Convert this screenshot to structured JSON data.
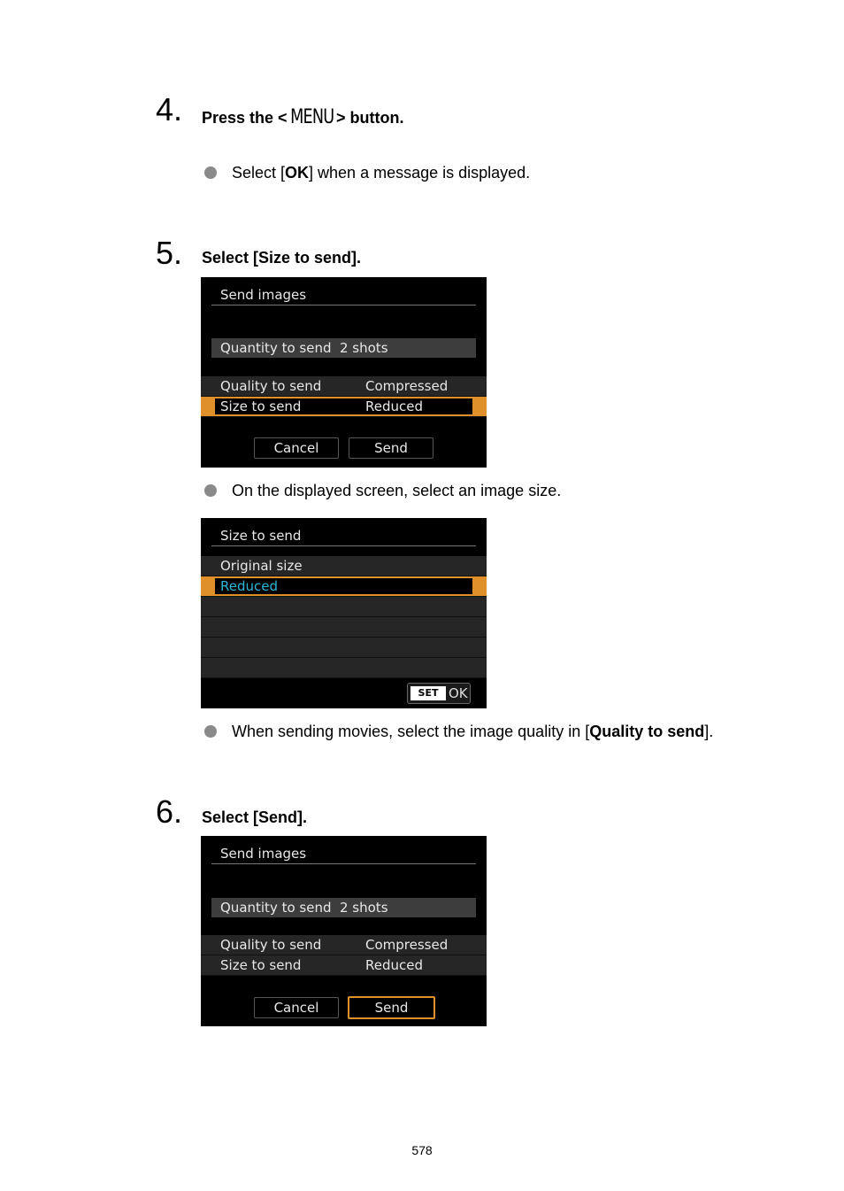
{
  "steps": [
    {
      "number": "4.",
      "title_prefix": "Press the <",
      "title_glyph": "MENU",
      "title_suffix": "> button.",
      "bullets": [
        {
          "pre": "Select [",
          "bold": "OK",
          "post": "] when a message is displayed."
        }
      ]
    },
    {
      "number": "5.",
      "title": "Select [Size to send].",
      "bullets": [
        {
          "text": "On the displayed screen, select an image size."
        },
        {
          "pre": "When sending movies, select the image quality in [",
          "bold": "Quality to send",
          "post": "]."
        }
      ]
    },
    {
      "number": "6.",
      "title": "Select [Send]."
    }
  ],
  "screens": {
    "send_images_a": {
      "title": "Send images",
      "quantity_label": "Quantity to send",
      "quantity_value": "2 shots",
      "rows": [
        {
          "label": "Quality to send",
          "value": "Compressed",
          "selected": false
        },
        {
          "label": "Size to send",
          "value": "Reduced",
          "selected": true
        }
      ],
      "cancel_label": "Cancel",
      "send_label": "Send",
      "focused_button": "none"
    },
    "size_to_send": {
      "title": "Size to send",
      "options": [
        {
          "label": "Original size",
          "selected": false
        },
        {
          "label": "Reduced",
          "selected": true
        }
      ],
      "set_label": "SET",
      "ok_label": "OK"
    },
    "send_images_b": {
      "title": "Send images",
      "quantity_label": "Quantity to send",
      "quantity_value": "2 shots",
      "rows": [
        {
          "label": "Quality to send",
          "value": "Compressed",
          "selected": false
        },
        {
          "label": "Size to send",
          "value": "Reduced",
          "selected": false
        }
      ],
      "cancel_label": "Cancel",
      "send_label": "Send",
      "focused_button": "send"
    }
  },
  "colors": {
    "highlight": "#e0902a",
    "selected_text": "#2bb5d8",
    "screen_bg": "#000000"
  },
  "page_number": "578"
}
